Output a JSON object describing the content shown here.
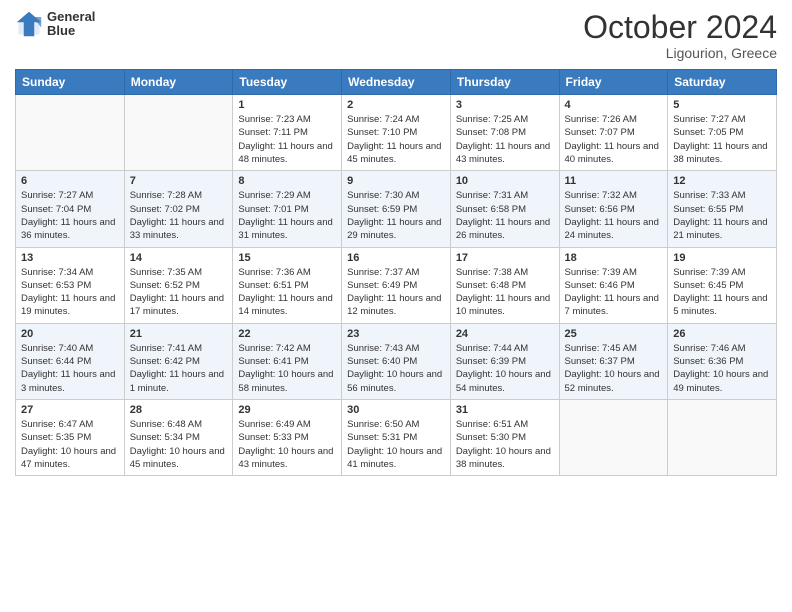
{
  "header": {
    "logo_line1": "General",
    "logo_line2": "Blue",
    "month": "October 2024",
    "location": "Ligourion, Greece"
  },
  "weekdays": [
    "Sunday",
    "Monday",
    "Tuesday",
    "Wednesday",
    "Thursday",
    "Friday",
    "Saturday"
  ],
  "weeks": [
    [
      {
        "day": "",
        "info": ""
      },
      {
        "day": "",
        "info": ""
      },
      {
        "day": "1",
        "info": "Sunrise: 7:23 AM\nSunset: 7:11 PM\nDaylight: 11 hours and 48 minutes."
      },
      {
        "day": "2",
        "info": "Sunrise: 7:24 AM\nSunset: 7:10 PM\nDaylight: 11 hours and 45 minutes."
      },
      {
        "day": "3",
        "info": "Sunrise: 7:25 AM\nSunset: 7:08 PM\nDaylight: 11 hours and 43 minutes."
      },
      {
        "day": "4",
        "info": "Sunrise: 7:26 AM\nSunset: 7:07 PM\nDaylight: 11 hours and 40 minutes."
      },
      {
        "day": "5",
        "info": "Sunrise: 7:27 AM\nSunset: 7:05 PM\nDaylight: 11 hours and 38 minutes."
      }
    ],
    [
      {
        "day": "6",
        "info": "Sunrise: 7:27 AM\nSunset: 7:04 PM\nDaylight: 11 hours and 36 minutes."
      },
      {
        "day": "7",
        "info": "Sunrise: 7:28 AM\nSunset: 7:02 PM\nDaylight: 11 hours and 33 minutes."
      },
      {
        "day": "8",
        "info": "Sunrise: 7:29 AM\nSunset: 7:01 PM\nDaylight: 11 hours and 31 minutes."
      },
      {
        "day": "9",
        "info": "Sunrise: 7:30 AM\nSunset: 6:59 PM\nDaylight: 11 hours and 29 minutes."
      },
      {
        "day": "10",
        "info": "Sunrise: 7:31 AM\nSunset: 6:58 PM\nDaylight: 11 hours and 26 minutes."
      },
      {
        "day": "11",
        "info": "Sunrise: 7:32 AM\nSunset: 6:56 PM\nDaylight: 11 hours and 24 minutes."
      },
      {
        "day": "12",
        "info": "Sunrise: 7:33 AM\nSunset: 6:55 PM\nDaylight: 11 hours and 21 minutes."
      }
    ],
    [
      {
        "day": "13",
        "info": "Sunrise: 7:34 AM\nSunset: 6:53 PM\nDaylight: 11 hours and 19 minutes."
      },
      {
        "day": "14",
        "info": "Sunrise: 7:35 AM\nSunset: 6:52 PM\nDaylight: 11 hours and 17 minutes."
      },
      {
        "day": "15",
        "info": "Sunrise: 7:36 AM\nSunset: 6:51 PM\nDaylight: 11 hours and 14 minutes."
      },
      {
        "day": "16",
        "info": "Sunrise: 7:37 AM\nSunset: 6:49 PM\nDaylight: 11 hours and 12 minutes."
      },
      {
        "day": "17",
        "info": "Sunrise: 7:38 AM\nSunset: 6:48 PM\nDaylight: 11 hours and 10 minutes."
      },
      {
        "day": "18",
        "info": "Sunrise: 7:39 AM\nSunset: 6:46 PM\nDaylight: 11 hours and 7 minutes."
      },
      {
        "day": "19",
        "info": "Sunrise: 7:39 AM\nSunset: 6:45 PM\nDaylight: 11 hours and 5 minutes."
      }
    ],
    [
      {
        "day": "20",
        "info": "Sunrise: 7:40 AM\nSunset: 6:44 PM\nDaylight: 11 hours and 3 minutes."
      },
      {
        "day": "21",
        "info": "Sunrise: 7:41 AM\nSunset: 6:42 PM\nDaylight: 11 hours and 1 minute."
      },
      {
        "day": "22",
        "info": "Sunrise: 7:42 AM\nSunset: 6:41 PM\nDaylight: 10 hours and 58 minutes."
      },
      {
        "day": "23",
        "info": "Sunrise: 7:43 AM\nSunset: 6:40 PM\nDaylight: 10 hours and 56 minutes."
      },
      {
        "day": "24",
        "info": "Sunrise: 7:44 AM\nSunset: 6:39 PM\nDaylight: 10 hours and 54 minutes."
      },
      {
        "day": "25",
        "info": "Sunrise: 7:45 AM\nSunset: 6:37 PM\nDaylight: 10 hours and 52 minutes."
      },
      {
        "day": "26",
        "info": "Sunrise: 7:46 AM\nSunset: 6:36 PM\nDaylight: 10 hours and 49 minutes."
      }
    ],
    [
      {
        "day": "27",
        "info": "Sunrise: 6:47 AM\nSunset: 5:35 PM\nDaylight: 10 hours and 47 minutes."
      },
      {
        "day": "28",
        "info": "Sunrise: 6:48 AM\nSunset: 5:34 PM\nDaylight: 10 hours and 45 minutes."
      },
      {
        "day": "29",
        "info": "Sunrise: 6:49 AM\nSunset: 5:33 PM\nDaylight: 10 hours and 43 minutes."
      },
      {
        "day": "30",
        "info": "Sunrise: 6:50 AM\nSunset: 5:31 PM\nDaylight: 10 hours and 41 minutes."
      },
      {
        "day": "31",
        "info": "Sunrise: 6:51 AM\nSunset: 5:30 PM\nDaylight: 10 hours and 38 minutes."
      },
      {
        "day": "",
        "info": ""
      },
      {
        "day": "",
        "info": ""
      }
    ]
  ]
}
